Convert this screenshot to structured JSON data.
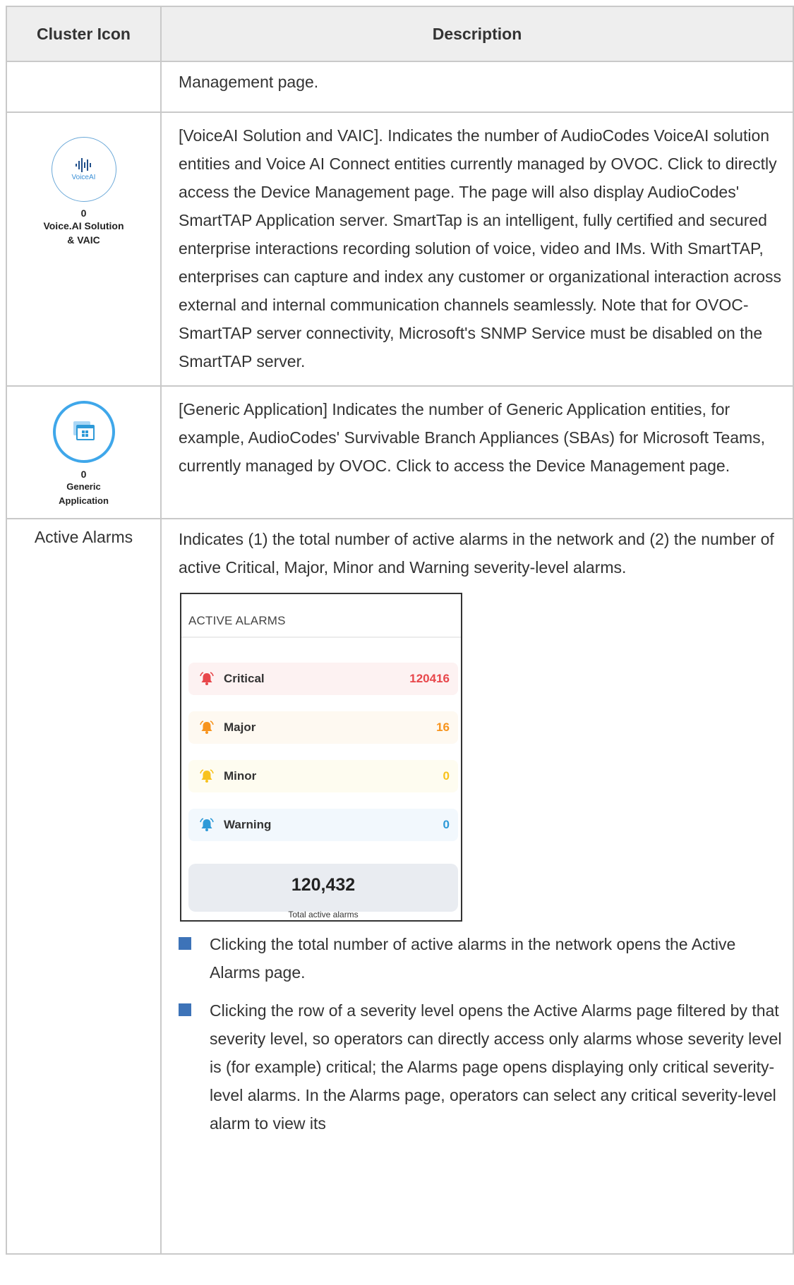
{
  "table": {
    "headers": {
      "col1": "Cluster Icon",
      "col2": "Description"
    },
    "row0": {
      "desc": "Management page."
    },
    "voiceai": {
      "icon_text": "VoiceAI",
      "count": "0",
      "label_line1": "Voice.AI Solution",
      "label_line2": "& VAIC",
      "desc": "[VoiceAI Solution and VAIC]. Indicates the number of AudioCodes VoiceAI solution entities and Voice AI Connect entities currently managed by OVOC. Click to directly access the Device Management page. The page will also display AudioCodes' SmartTAP Application server. SmartTap is an intelligent, fully certified and secured enterprise interactions recording solution of voice, video and IMs. With SmartTAP, enterprises can capture and index any customer or organizational interaction across external and internal communication channels seamlessly. Note that for OVOC-SmartTAP server connectivity, Microsoft's SNMP Service must be disabled on the SmartTAP server."
    },
    "generic": {
      "count": "0",
      "label_line1": "Generic",
      "label_line2": "Application",
      "desc": "[Generic Application] Indicates the number of Generic Application entities, for example, AudioCodes' Survivable Branch Appliances (SBAs) for Microsoft Teams, currently managed by OVOC. Click to access the Device Management page."
    },
    "alarms": {
      "label": "Active Alarms",
      "desc": "Indicates (1) the total number of active alarms in the network and (2) the number of active Critical, Major, Minor and Warning severity-level alarms.",
      "widget": {
        "title": "ACTIVE ALARMS",
        "rows": [
          {
            "name": "Critical",
            "value": "120416",
            "color": "#e8474b",
            "bg": "#fdf2f2"
          },
          {
            "name": "Major",
            "value": "16",
            "color": "#f7941d",
            "bg": "#fef9f1"
          },
          {
            "name": "Minor",
            "value": "0",
            "color": "#f8c21c",
            "bg": "#fefcf0"
          },
          {
            "name": "Warning",
            "value": "0",
            "color": "#2e9ad8",
            "bg": "#f2f8fd"
          }
        ],
        "total": "120,432",
        "total_label": "Total active alarms"
      },
      "bullets": [
        "Clicking the total number of active alarms in the network opens the Active Alarms page.",
        "Clicking the row of a severity level opens the Active Alarms page filtered by that severity level, so operators can directly access only alarms whose severity level is (for example) critical; the Alarms page opens displaying only critical severity-level alarms. In the Alarms page, operators can select any critical severity-level alarm to view its"
      ]
    }
  }
}
